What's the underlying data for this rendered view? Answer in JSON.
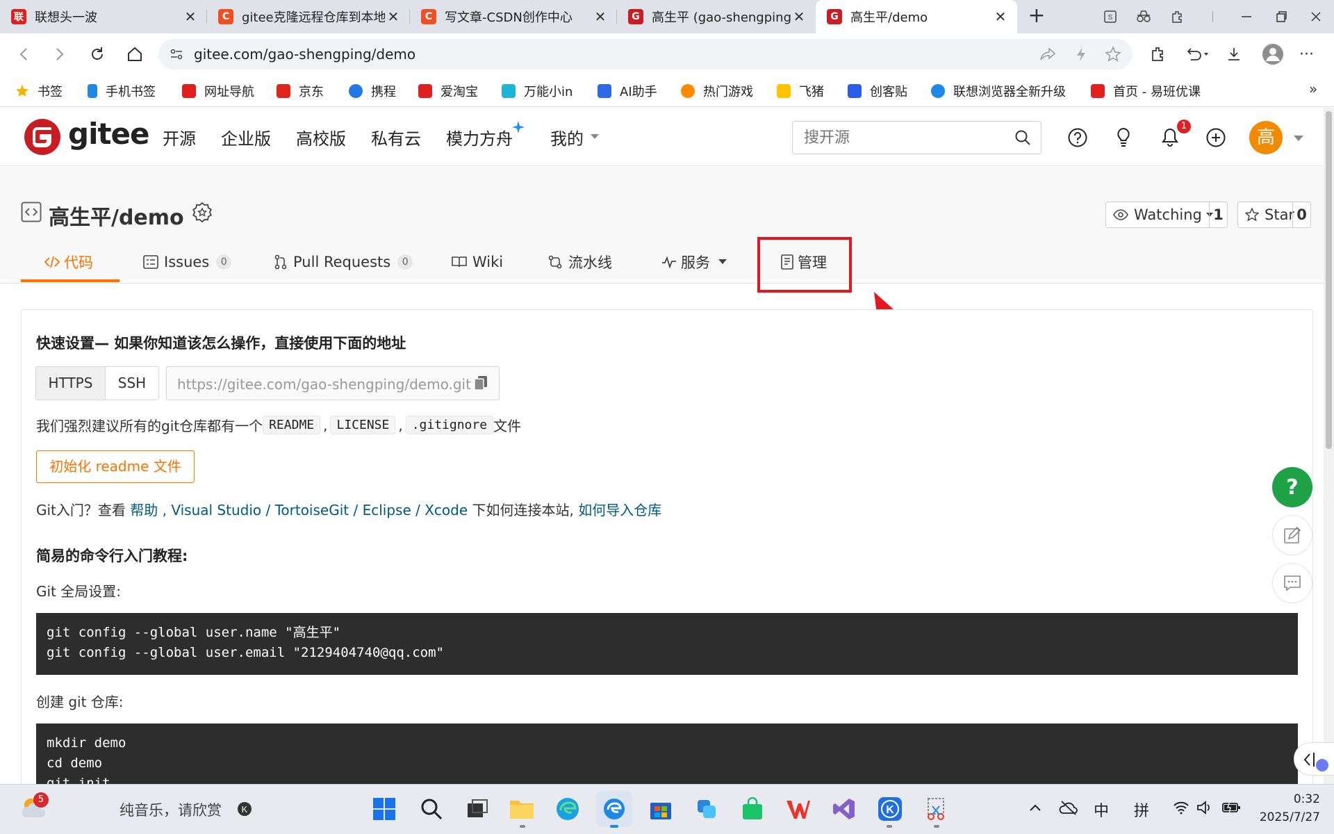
{
  "browser": {
    "tabs": [
      {
        "title": "联想头一波",
        "icon": "lenovo-icon",
        "color": "#e02020"
      },
      {
        "title": "gitee克隆远程仓库到本地",
        "icon": "csdn-icon",
        "color": "#f04e23"
      },
      {
        "title": "写文章-CSDN创作中心",
        "icon": "csdn-icon",
        "color": "#f04e23"
      },
      {
        "title": "高生平 (gao-shengping)",
        "icon": "gitee-icon",
        "color": "#c71d23"
      },
      {
        "title": "高生平/demo",
        "icon": "gitee-icon",
        "color": "#c71d23",
        "active": true
      }
    ],
    "new_tab": "+",
    "url": "gitee.com/gao-shengping/demo",
    "bookmarks": [
      {
        "label": "书签",
        "color": "#f4b400"
      },
      {
        "label": "手机书签",
        "color": "#1e88e5"
      },
      {
        "label": "网址导航",
        "color": "#e02020"
      },
      {
        "label": "京东",
        "color": "#e1251b"
      },
      {
        "label": "携程",
        "color": "#2577e3"
      },
      {
        "label": "爱淘宝",
        "color": "#e02020"
      },
      {
        "label": "万能小in",
        "color": "#1fb6d6"
      },
      {
        "label": "AI助手",
        "color": "#2d6ae3"
      },
      {
        "label": "热门游戏",
        "color": "#ff8a00"
      },
      {
        "label": "飞猪",
        "color": "#ffc300"
      },
      {
        "label": "创客贴",
        "color": "#2a5ee8"
      },
      {
        "label": "联想浏览器全新升级",
        "color": "#1e88e5"
      },
      {
        "label": "首页 - 易班优课",
        "color": "#e02020"
      }
    ],
    "bookmarks_more": "»"
  },
  "gitee": {
    "logo_text": "gitee",
    "brand_color": "#c71d23",
    "nav": [
      "开源",
      "企业版",
      "高校版",
      "私有云",
      "模力方舟",
      "我的"
    ],
    "search_placeholder": "搜开源",
    "notifications_count": "1",
    "avatar_initial": "高",
    "avatar_color": "#f08a00"
  },
  "repo": {
    "title": "高生平/demo",
    "watch_label": "Watching",
    "watch_count": "1",
    "star_label": "Star",
    "star_count": "0",
    "tabs": [
      {
        "label": "代码",
        "active": true
      },
      {
        "label": "Issues",
        "count": "0"
      },
      {
        "label": "Pull Requests",
        "count": "0"
      },
      {
        "label": "Wiki"
      },
      {
        "label": "流水线"
      },
      {
        "label": "服务"
      },
      {
        "label": "管理"
      }
    ],
    "accent": "#fe7300"
  },
  "quick_setup": {
    "heading": "快速设置— 如果你知道该怎么操作，直接使用下面的地址",
    "proto_https": "HTTPS",
    "proto_ssh": "SSH",
    "clone_url": "https://gitee.com/gao-shengping/demo.git",
    "recommend_prefix": "我们强烈建议所有的git仓库都有一个",
    "file_readme": "README",
    "file_license": "LICENSE",
    "file_gitignore": ".gitignore",
    "recommend_suffix": "文件",
    "sep_comma": ",",
    "init_button": "初始化 readme 文件",
    "help_prefix": "Git入门？查看",
    "help_link": "帮助",
    "help_comma": ",",
    "vs_link": "Visual Studio",
    "tortoise_link": "TortoiseGit",
    "eclipse_link": "Eclipse",
    "xcode_link": "Xcode",
    "slash": "/",
    "help_mid": "下如何连接本站,",
    "import_link": "如何导入仓库",
    "tutorial_heading": "简易的命令行入门教程:",
    "global_label": "Git 全局设置:",
    "global_cmds": [
      "git config --global user.name \"高生平\"",
      "git config --global user.email \"2129404740@qq.com\""
    ],
    "create_label": "创建 git 仓库:",
    "create_cmds": [
      "mkdir demo",
      "cd demo",
      "git init"
    ]
  },
  "taskbar": {
    "weather_badge": "5",
    "music_text": "纯音乐，请欣赏",
    "ime_cn": "中",
    "ime_pinyin": "拼",
    "time": "0:32",
    "date": "2025/7/27"
  }
}
